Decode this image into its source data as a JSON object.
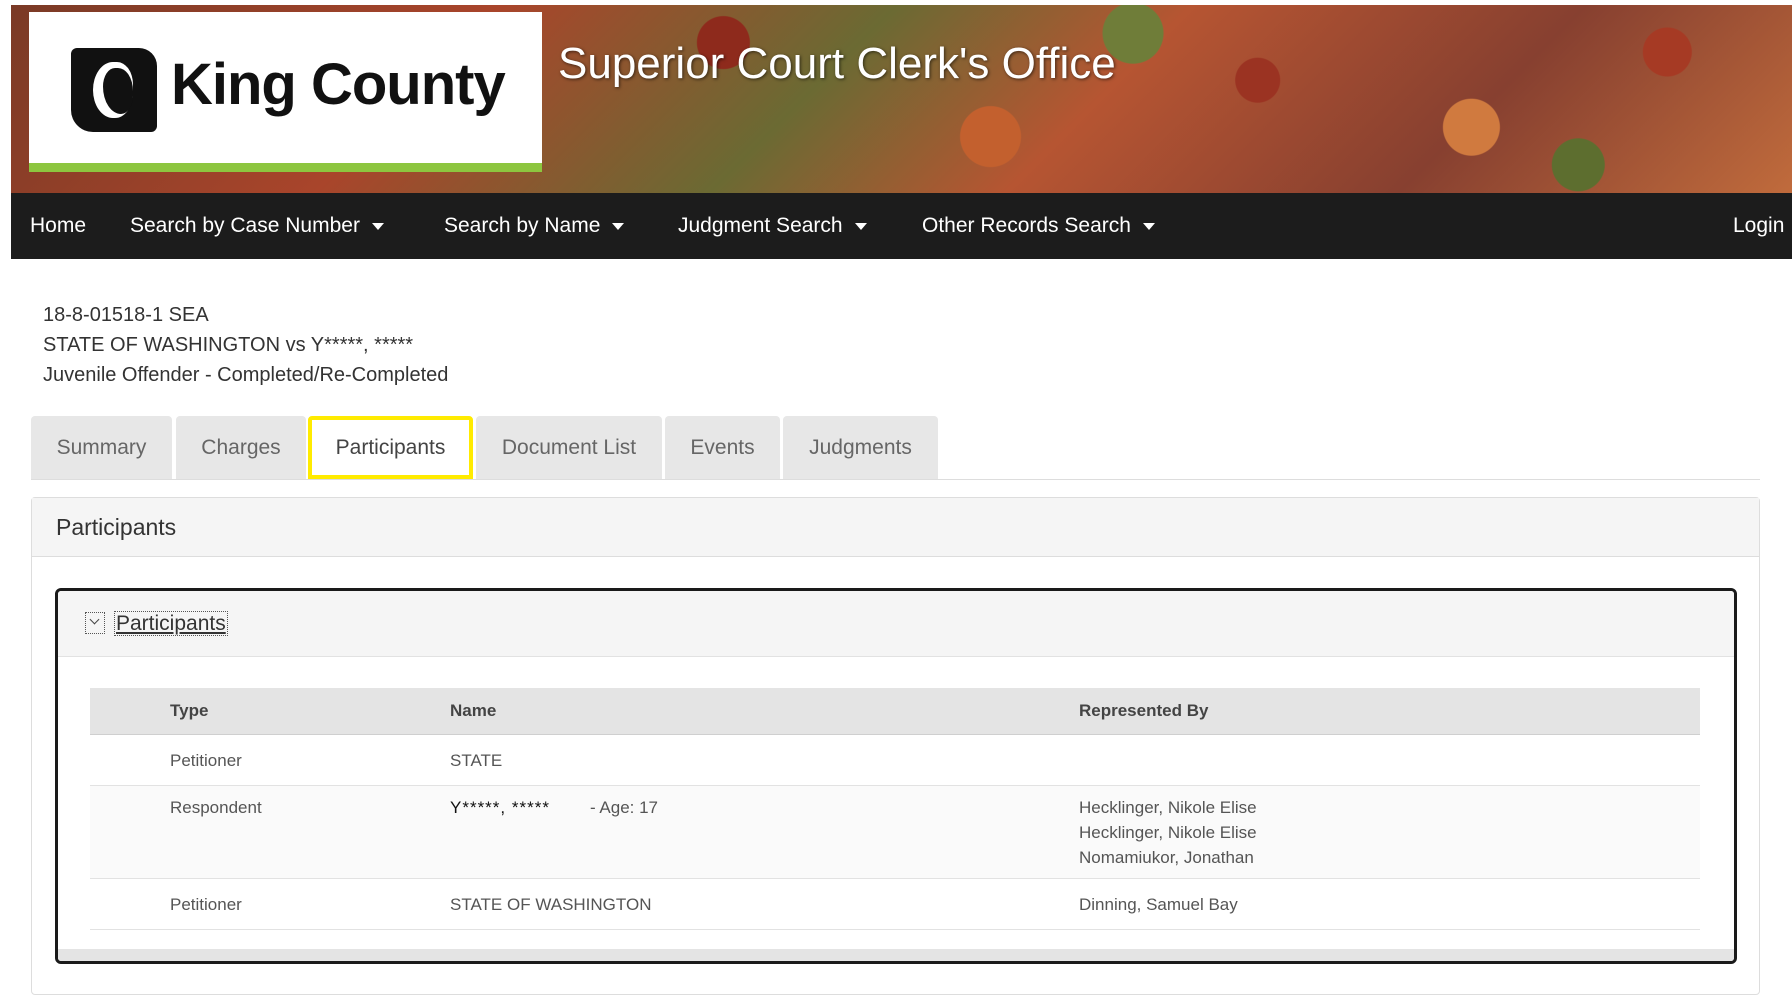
{
  "header": {
    "logo_text": "King County",
    "site_title": "Superior Court Clerk's Office"
  },
  "nav": {
    "home": "Home",
    "search_case_number": "Search by Case Number",
    "search_name": "Search by Name",
    "judgment_search": "Judgment Search",
    "other_records": "Other Records Search",
    "login": "Login"
  },
  "case": {
    "number": "18-8-01518-1 SEA",
    "title": "STATE OF WASHINGTON vs Y*****, *****",
    "type": "Juvenile Offender - Completed/Re-Completed"
  },
  "tabs": [
    {
      "label": "Summary"
    },
    {
      "label": "Charges"
    },
    {
      "label": "Participants"
    },
    {
      "label": "Document List"
    },
    {
      "label": "Events"
    },
    {
      "label": "Judgments"
    }
  ],
  "panel": {
    "title": "Participants",
    "section_title": "Participants"
  },
  "participants": {
    "headers": {
      "type": "Type",
      "name": "Name",
      "represented_by": "Represented By"
    },
    "rows": [
      {
        "type": "Petitioner",
        "name": "STATE",
        "age": "",
        "represented_by": []
      },
      {
        "type": "Respondent",
        "name": "Y*****, *****",
        "age": "- Age: 17",
        "represented_by": [
          "Hecklinger, Nikole Elise",
          "Hecklinger, Nikole Elise",
          "Nomamiukor, Jonathan"
        ]
      },
      {
        "type": "Petitioner",
        "name": "STATE OF WASHINGTON",
        "age": "",
        "represented_by": [
          "Dinning, Samuel Bay"
        ]
      }
    ]
  },
  "colors": {
    "nav_bg": "#1c1c1c",
    "logo_accent": "#8dc63f",
    "active_tab_highlight": "#ffeb00"
  }
}
